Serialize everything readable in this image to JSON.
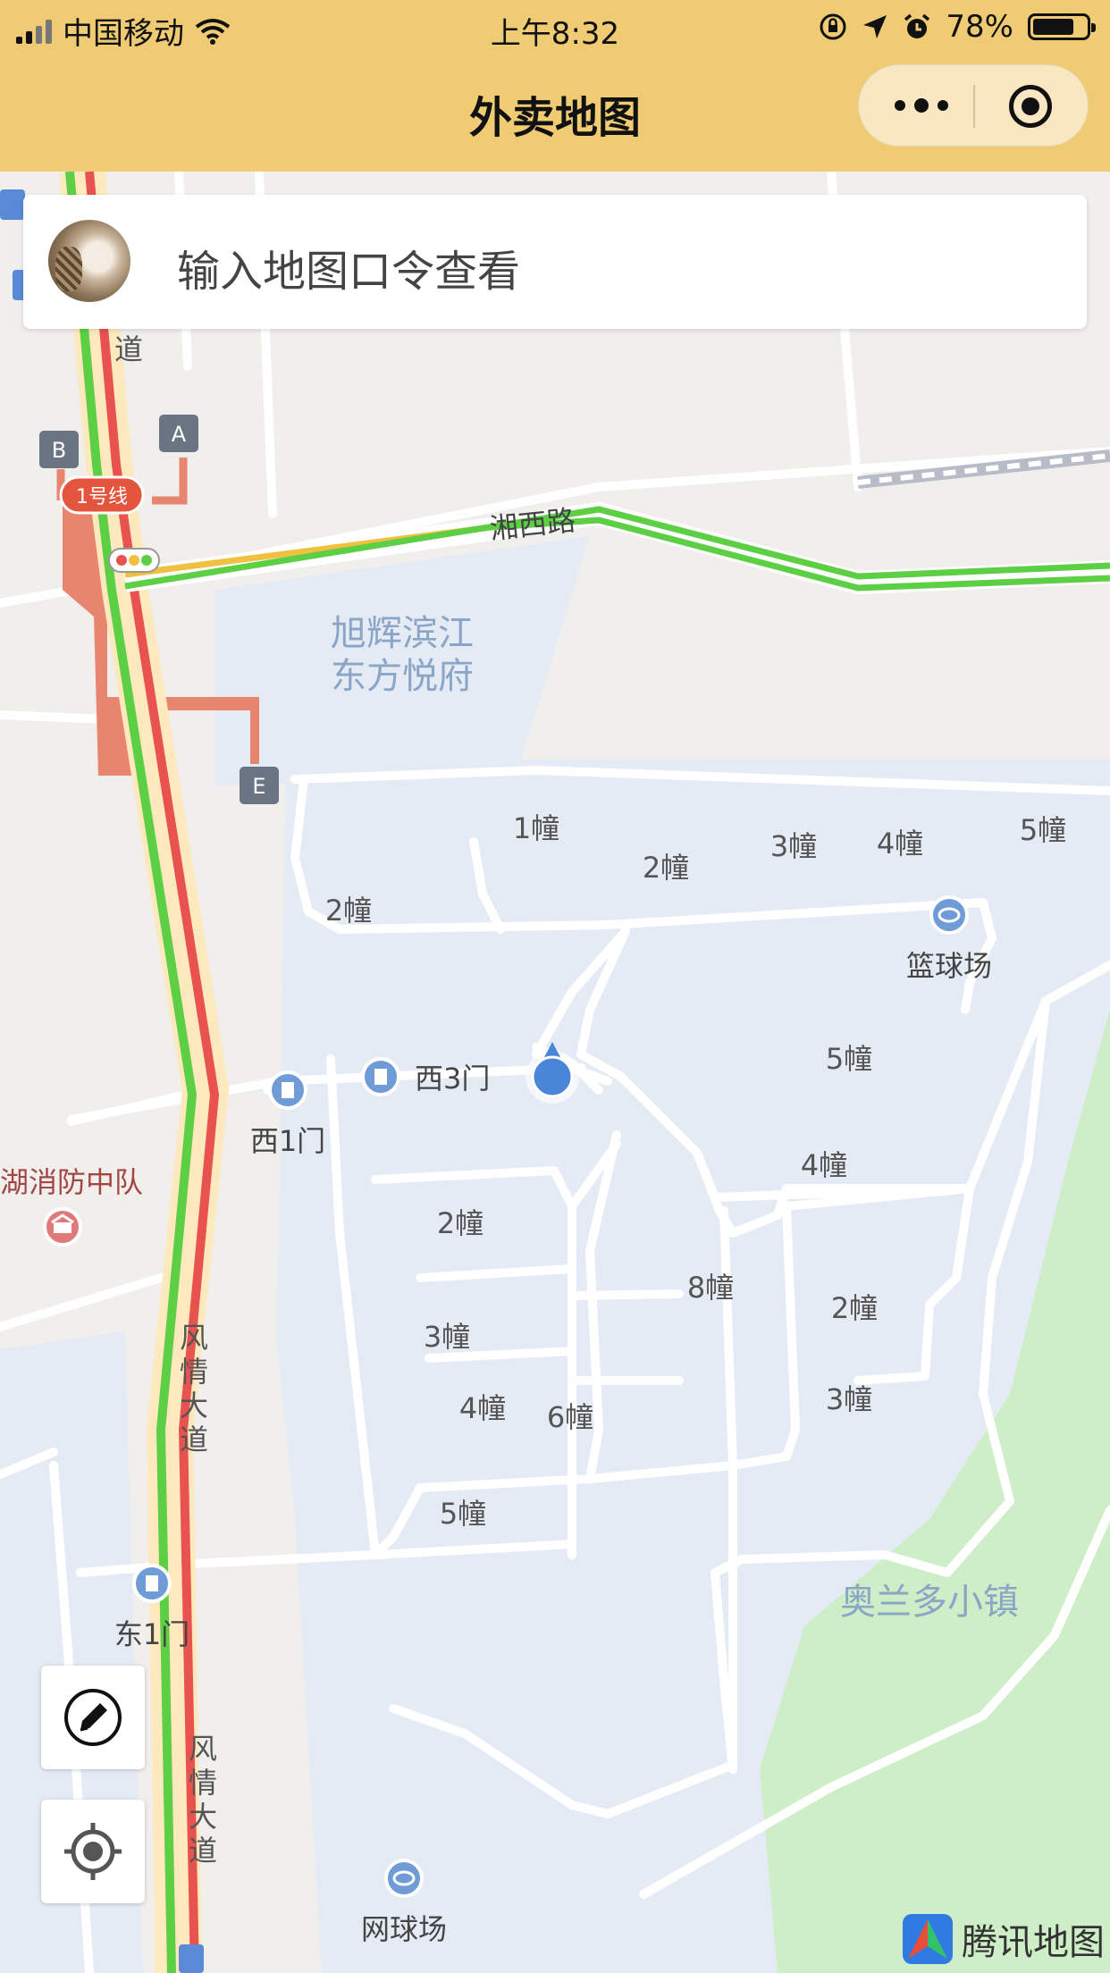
{
  "status_bar": {
    "carrier": "中国移动",
    "time": "上午8:32",
    "battery": "78%",
    "battery_level": 0.78
  },
  "nav": {
    "title": "外卖地图"
  },
  "search": {
    "placeholder": "输入地图口令查看"
  },
  "map": {
    "roads": {
      "xiangxi": "湘西路",
      "fengqing_1": "风情大道",
      "fengqing_2": "风情大道",
      "top_fragment": "道"
    },
    "metro": {
      "line": "1号线",
      "exit_a": "A",
      "exit_b": "B",
      "exit_e": "E"
    },
    "areas": {
      "xuhui_line1": "旭辉滨江",
      "xuhui_line2": "东方悦府",
      "orlando": "奥兰多小镇"
    },
    "gates": {
      "west3": "西3门",
      "west1": "西1门",
      "east1": "东1门"
    },
    "pois": {
      "basketball": "篮球场",
      "tennis": "网球场",
      "fire_station": "湖消防中队"
    },
    "buildings": {
      "b1": "1幢",
      "b2_top": "2幢",
      "b3_top": "3幢",
      "b4_top": "4幢",
      "b5_top": "5幢",
      "b2_left": "2幢",
      "b5_mid": "5幢",
      "b4_mid": "4幢",
      "b2_center": "2幢",
      "b8": "8幢",
      "b2_right": "2幢",
      "b3_center": "3幢",
      "b4_center": "4幢",
      "b6": "6幢",
      "b3_right": "3幢",
      "b5_bottom": "5幢"
    }
  },
  "attribution": "腾讯地图",
  "icons": {
    "signal": "signal-icon",
    "wifi": "wifi-icon",
    "rotation_lock": "rotation-lock-icon",
    "location": "location-arrow-icon",
    "alarm": "alarm-icon",
    "more": "more-dots-icon",
    "close": "close-miniprogram-icon",
    "edit": "pencil-icon",
    "locate": "locate-icon",
    "gate": "gate-icon",
    "fire": "fire-station-icon",
    "court": "court-icon",
    "traffic_light": "traffic-light-icon"
  },
  "colors": {
    "header": "#efcb74",
    "residential": "#e4ebf5",
    "park": "#cdeec6",
    "traffic_green": "#5ccf45",
    "traffic_red": "#e8524f",
    "metro": "#e4604a",
    "my_location": "#4a86d8"
  }
}
